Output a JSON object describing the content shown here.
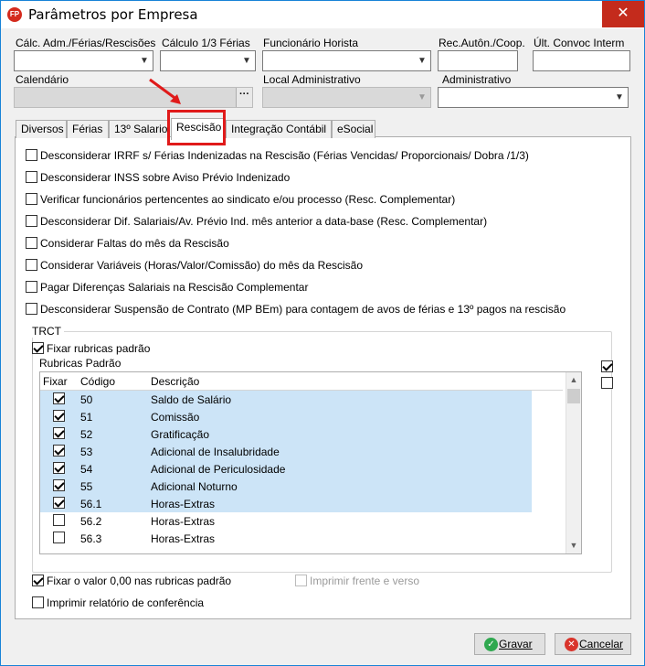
{
  "window": {
    "title": "Parâmetros por Empresa",
    "icon_text": "FP",
    "close_symbol": "✕"
  },
  "fields": {
    "calc_adm": {
      "label": "Cálc. Adm./Férias/Rescisões",
      "value": ""
    },
    "calc_13": {
      "label": "Cálculo 1/3 Férias",
      "value": ""
    },
    "func_horista": {
      "label": "Funcionário Horista",
      "value": ""
    },
    "rec_auton": {
      "label": "Rec.Autôn./Coop.",
      "value": ""
    },
    "ult_convoc": {
      "label": "Últ. Convoc Interm",
      "value": ""
    },
    "calendario": {
      "label": "Calendário",
      "value": "",
      "button": "···"
    },
    "local_adm": {
      "label": "Local Administrativo",
      "value": ""
    },
    "administrativo": {
      "label": "Administrativo",
      "value": ""
    }
  },
  "tabs": [
    {
      "label": "Diversos"
    },
    {
      "label": "Férias"
    },
    {
      "label": "13º Salario"
    },
    {
      "label": "Rescisão"
    },
    {
      "label": "Integração Contábil"
    },
    {
      "label": "eSocial"
    }
  ],
  "options": [
    {
      "label": "Desconsiderar IRRF s/ Férias Indenizadas na Rescisão (Férias Vencidas/ Proporcionais/ Dobra /1/3)",
      "checked": false
    },
    {
      "label": "Desconsiderar INSS sobre Aviso Prévio Indenizado",
      "checked": false
    },
    {
      "label": "Verificar funcionários pertencentes ao sindicato e/ou processo (Resc. Complementar)",
      "checked": false
    },
    {
      "label": "Desconsiderar Dif. Salariais/Av. Prévio Ind. mês anterior a data-base (Resc. Complementar)",
      "checked": false
    },
    {
      "label": "Considerar Faltas do mês da Rescisão",
      "checked": false
    },
    {
      "label": "Considerar Variáveis (Horas/Valor/Comissão) do mês da Rescisão",
      "checked": false
    },
    {
      "label": "Pagar Diferenças Salariais na Rescisão Complementar",
      "checked": false
    },
    {
      "label": "Desconsiderar Suspensão de Contrato (MP BEm) para contagem de avos de férias e 13º pagos na rescisão",
      "checked": false
    }
  ],
  "trct": {
    "title": "TRCT",
    "fixar_padrao": {
      "label": "Fixar rubricas padrão",
      "checked": true
    },
    "rubricas_title": "Rubricas Padrão",
    "columns": {
      "fixar": "Fixar",
      "codigo": "Código",
      "descricao": "Descrição"
    },
    "rows": [
      {
        "fixar": true,
        "codigo": "50",
        "descricao": "Saldo de Salário"
      },
      {
        "fixar": true,
        "codigo": "51",
        "descricao": "Comissão"
      },
      {
        "fixar": true,
        "codigo": "52",
        "descricao": "Gratificação"
      },
      {
        "fixar": true,
        "codigo": "53",
        "descricao": "Adicional de Insalubridade"
      },
      {
        "fixar": true,
        "codigo": "54",
        "descricao": "Adicional de Periculosidade"
      },
      {
        "fixar": true,
        "codigo": "55",
        "descricao": "Adicional Noturno"
      },
      {
        "fixar": true,
        "codigo": "56.1",
        "descricao": "Horas-Extras"
      },
      {
        "fixar": false,
        "codigo": "56.2",
        "descricao": "Horas-Extras"
      },
      {
        "fixar": false,
        "codigo": "56.3",
        "descricao": "Horas-Extras"
      }
    ],
    "side_checks": [
      true,
      false
    ]
  },
  "bottom_options": {
    "fixar_zero": {
      "label": "Fixar o valor 0,00 nas rubricas padrão",
      "checked": true
    },
    "imprimir_frente": {
      "label": "Imprimir frente e verso",
      "checked": false
    },
    "imprimir_relatorio": {
      "label": "Imprimir relatório de conferência",
      "checked": false
    }
  },
  "buttons": {
    "gravar": {
      "label": "Gravar",
      "color": "#2fa84f"
    },
    "cancelar": {
      "label": "Cancelar",
      "color": "#d9342b"
    }
  },
  "colors": {
    "accent": "#1883d7",
    "highlight": "#e01a1a",
    "selection": "#cce4f7"
  }
}
